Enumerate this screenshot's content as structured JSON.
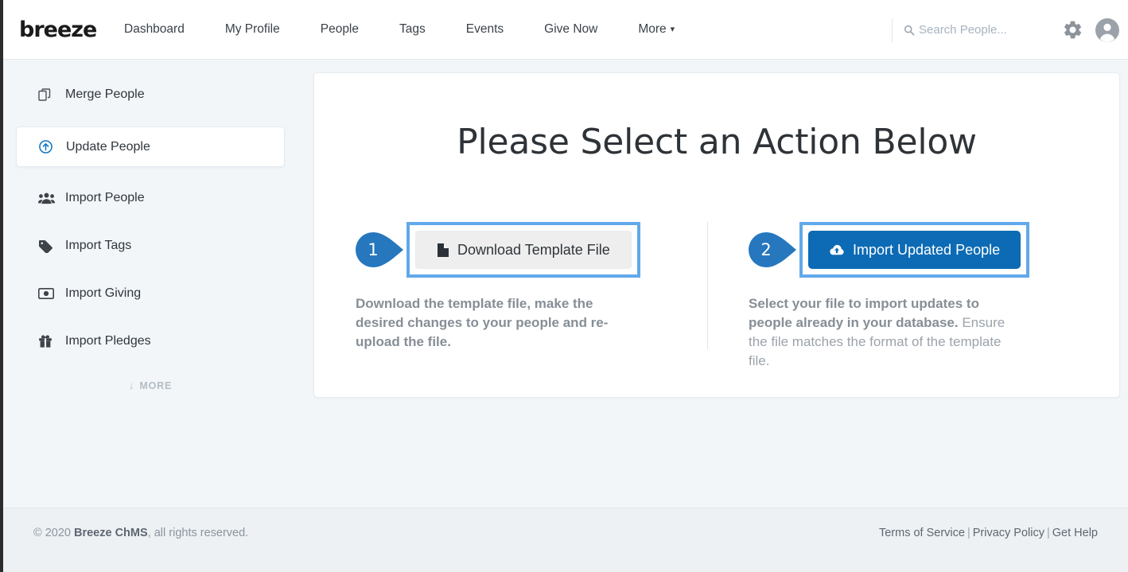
{
  "header": {
    "brand": "breeze",
    "nav": [
      {
        "label": "Dashboard",
        "icon": null
      },
      {
        "label": "My Profile",
        "icon": null
      },
      {
        "label": "People",
        "icon": null
      },
      {
        "label": "Tags",
        "icon": null
      },
      {
        "label": "Events",
        "icon": null
      },
      {
        "label": "Give Now",
        "icon": null
      },
      {
        "label": "More",
        "icon": "chevron-down-icon"
      }
    ],
    "search": {
      "placeholder": "Search People...",
      "value": "",
      "icon": "search-icon"
    },
    "settings_icon": "gear-icon",
    "account_icon": "user-avatar-icon"
  },
  "sidebar": {
    "items": [
      {
        "label": "Merge People",
        "icon": "merge-copy-icon",
        "active": false
      },
      {
        "label": "Update People",
        "icon": "arrow-up-circle-icon",
        "active": true
      },
      {
        "label": "Import People",
        "icon": "users-group-icon",
        "active": false
      },
      {
        "label": "Import Tags",
        "icon": "tag-icon",
        "active": false
      },
      {
        "label": "Import Giving",
        "icon": "money-bill-icon",
        "active": false
      },
      {
        "label": "Import Pledges",
        "icon": "gift-icon",
        "active": false
      }
    ],
    "more": {
      "label": "MORE",
      "icon": "arrow-down-icon"
    }
  },
  "main": {
    "title": "Please Select an Action Below",
    "steps": [
      {
        "number": "1",
        "button_label": "Download Template File",
        "button_icon": "file-download-icon",
        "button_style": "secondary",
        "desc_bold": "Download the template file, make the desired changes to your people and re-upload the file.",
        "desc_regular": ""
      },
      {
        "number": "2",
        "button_label": "Import Updated People",
        "button_icon": "cloud-upload-icon",
        "button_style": "primary",
        "desc_bold": "Select your file to import updates to people already in your database.",
        "desc_regular": " Ensure the file matches the format of the template file."
      }
    ]
  },
  "footer": {
    "copyright_prefix": "© 2020 ",
    "copyright_brand": "Breeze ChMS",
    "copyright_suffix": ", all rights reserved.",
    "links": [
      {
        "label": "Terms of Service"
      },
      {
        "label": "Privacy Policy"
      },
      {
        "label": "Get Help"
      }
    ],
    "separator": "|"
  },
  "colors": {
    "accent_blue": "#0d6bb5",
    "highlight_blue": "#61a9ea",
    "marker_blue": "#2677bd",
    "page_bg": "#f2f6f9",
    "footer_bg": "#eef1f4",
    "muted_text": "#9ba3ab"
  }
}
